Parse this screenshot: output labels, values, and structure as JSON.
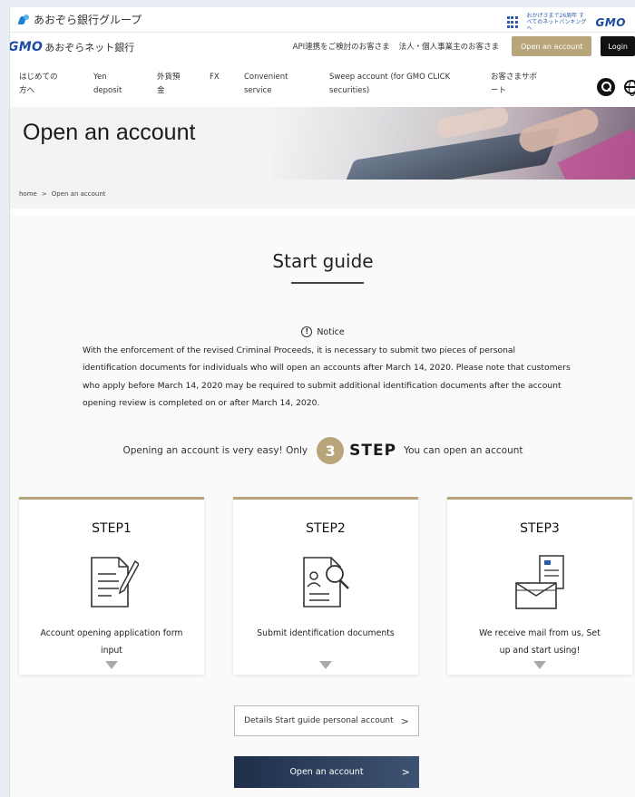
{
  "group_bar": {
    "logo_text": "あおぞら銀行グループ",
    "anniversary_text": "おかげさまで26周年 すべてのネットバンキングへ",
    "gmo_label": "GMO"
  },
  "brand_bar": {
    "brand_gmo": "GMO",
    "brand_name": "あおぞらネット銀行",
    "link_api": "API連携をご検討のお客さま",
    "link_corporate": "法人・個人事業主のお客さま",
    "open_account_label": "Open an account",
    "login_label": "Login"
  },
  "nav": {
    "items": [
      {
        "label": "はじめての\n方へ"
      },
      {
        "label": "Yen\ndeposit"
      },
      {
        "label": "外貨預\n金"
      },
      {
        "label": "FX"
      },
      {
        "label": "Convenient\nservice"
      },
      {
        "label": "Sweep account (for GMO CLICK\nsecurities)"
      },
      {
        "label": "お客さまサポ\nート"
      }
    ]
  },
  "hero": {
    "title": "Open an account"
  },
  "breadcrumb": {
    "home": "home",
    "separator": ">",
    "current": "Open an account"
  },
  "guide": {
    "title": "Start guide",
    "notice_label": "Notice",
    "notice_icon_glyph": "!",
    "notice_text": "With the enforcement of the revised Criminal Proceeds, it is necessary to submit two pieces of personal identification documents for individuals who will open an accounts after March 14, 2020. Please note that customers who apply before March 14, 2020 may be required to submit additional identification documents after the account opening review is completed on or after March 14, 2020.",
    "step_prefix": "Opening an account is very easy! Only",
    "step_number": "3",
    "step_word": "STEP",
    "step_suffix": "You can open an account"
  },
  "steps": [
    {
      "title": "STEP1",
      "icon": "form-pen-icon",
      "text": "Account opening application form input"
    },
    {
      "title": "STEP2",
      "icon": "document-search-icon",
      "text": "Submit identification documents"
    },
    {
      "title": "STEP3",
      "icon": "mail-card-icon",
      "text": "We receive mail from us, Set up and start using!"
    }
  ],
  "buttons": {
    "details_label": "Details Start guide personal account",
    "open_label": "Open an account",
    "chevron": ">"
  },
  "colors": {
    "accent_gold": "#b8a57a",
    "brand_blue": "#1b4aa0",
    "dark_button": "#1f2f4a"
  }
}
